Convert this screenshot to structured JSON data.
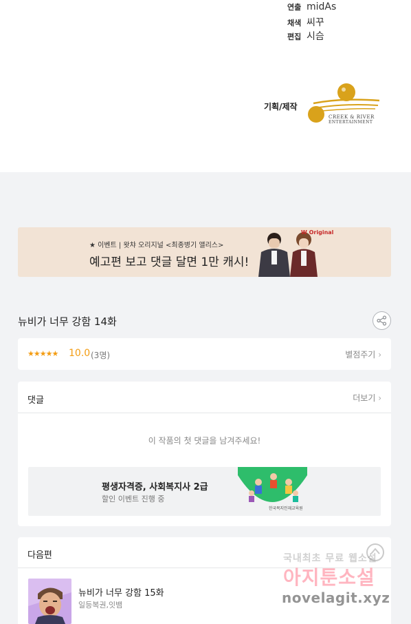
{
  "credits": {
    "rows": [
      {
        "key": "연출",
        "value": "midAs"
      },
      {
        "key": "채색",
        "value": "씨꾸"
      },
      {
        "key": "편집",
        "value": "시슴"
      }
    ],
    "planning_label": "기획/제작",
    "logo_line1": "CREEK & RIVER",
    "logo_line2": "ENTERTAINMENT",
    "logo_color": "#d9a21b"
  },
  "banner": {
    "small_text": "★ 이벤트 | 왓챠 오리지널 <최종병기 앨리스>",
    "headline": "예고편 보고 댓글 달면 1만 캐시!",
    "badge": "W Original"
  },
  "episode": {
    "title": "뉴비가 너무 강함 14화",
    "share_icon": "share-icon"
  },
  "rating": {
    "stars": "★★★★★",
    "score": "10.0",
    "count": "(3명)",
    "rate_label": "별점주기",
    "accent": "#f39c12"
  },
  "comments": {
    "header": "댓글",
    "more_label": "더보기",
    "empty_message": "이 작품의 첫 댓글을 남겨주세요!",
    "ad": {
      "title": "평생자격증, 사회복지사 2급",
      "subtitle": "할인 이벤트 진행 중",
      "footer": "한국복지인재교육원",
      "accent": "#2ebd6b"
    }
  },
  "next": {
    "header": "다음편",
    "title": "뉴비가 너무 강함 15화",
    "author": "일등복권,잇뱀"
  },
  "watermark": {
    "line1": "국내최초 무료 웹소설",
    "line2": "아지툰소설",
    "line3": "novelagit.xyz"
  }
}
